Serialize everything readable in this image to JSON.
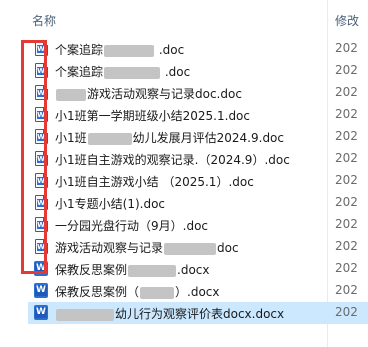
{
  "header": {
    "name_label": "名称",
    "modified_label": "修改"
  },
  "files": [
    {
      "prefix": "个案追踪",
      "suffix": " .doc",
      "type": "doc",
      "modified": "202"
    },
    {
      "prefix": "个案追踪",
      "suffix": " .doc",
      "type": "doc",
      "modified": "202"
    },
    {
      "prefix": "",
      "suffix": "游戏活动观察与记录doc.doc",
      "type": "doc",
      "modified": "202"
    },
    {
      "prefix": "小1班第一学期班级小结2025.1.doc",
      "suffix": "",
      "type": "doc",
      "modified": "202"
    },
    {
      "prefix": "小1班",
      "suffix": "幼儿发展月评估2024.9.doc",
      "type": "doc",
      "modified": "202"
    },
    {
      "prefix": "小1班自主游戏的观察记录.（2024.9）.doc",
      "suffix": "",
      "type": "doc",
      "modified": "202"
    },
    {
      "prefix": "小1班自主游戏小结 （2025.1）.doc",
      "suffix": "",
      "type": "doc",
      "modified": "202"
    },
    {
      "prefix": "小1专题小结(1).doc",
      "suffix": "",
      "type": "doc",
      "modified": "202"
    },
    {
      "prefix": "一分园光盘行动（9月）.doc",
      "suffix": "",
      "type": "doc",
      "modified": "202"
    },
    {
      "prefix": "游戏活动观察与记录",
      "suffix": "doc",
      "type": "doc",
      "modified": "202"
    },
    {
      "prefix": "保教反思案例",
      "suffix": ".docx",
      "type": "docx",
      "modified": "202"
    },
    {
      "prefix": "保教反思案例（",
      "suffix": "）.docx",
      "type": "docx",
      "modified": "202"
    },
    {
      "prefix": "",
      "suffix": "幼儿行为观察评价表docx.docx",
      "type": "docx",
      "modified": "202"
    }
  ],
  "icon_names": {
    "doc": "word-doc-icon",
    "docx": "word-docx-icon"
  },
  "colors": {
    "highlight_box": "#e53935",
    "selection": "#cce8ff",
    "word_blue": "#2b6fd1"
  }
}
